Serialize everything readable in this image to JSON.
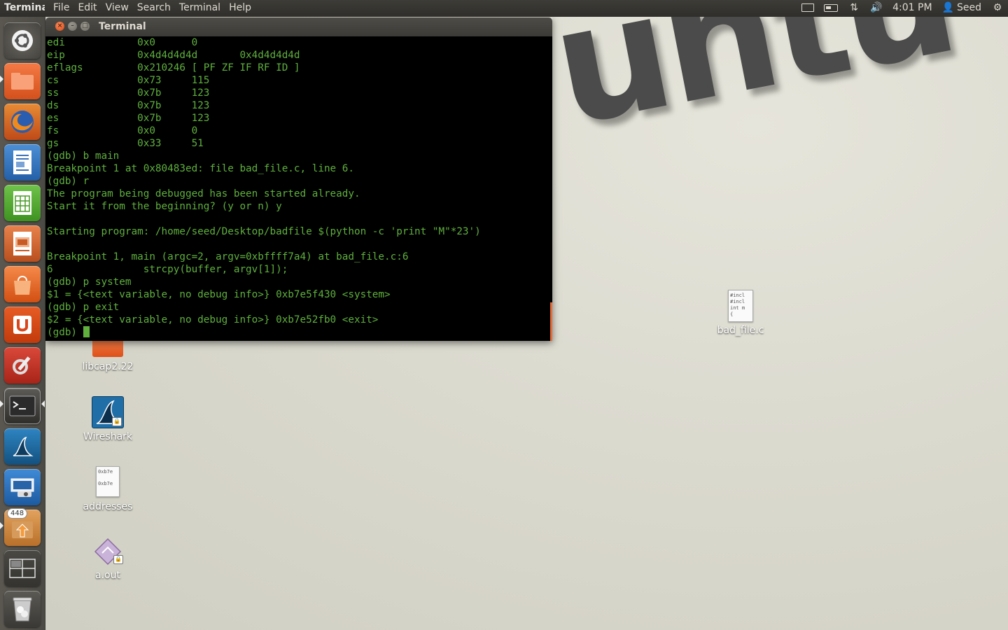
{
  "panel": {
    "app_name": "Terminal",
    "menu": [
      "File",
      "Edit",
      "View",
      "Search",
      "Terminal",
      "Help"
    ],
    "time": "4:01 PM",
    "user": "Seed"
  },
  "launcher": {
    "items": [
      {
        "name": "dash-home",
        "icon": "ubuntu-logo-icon"
      },
      {
        "name": "files",
        "icon": "folder-icon"
      },
      {
        "name": "firefox",
        "icon": "firefox-icon"
      },
      {
        "name": "libreoffice-writer",
        "icon": "writer-icon"
      },
      {
        "name": "libreoffice-calc",
        "icon": "calc-icon"
      },
      {
        "name": "libreoffice-impress",
        "icon": "impress-icon"
      },
      {
        "name": "software-center",
        "icon": "shopping-bag-icon"
      },
      {
        "name": "ubuntu-one",
        "icon": "ubuntu-one-icon"
      },
      {
        "name": "system-settings",
        "icon": "settings-icon"
      },
      {
        "name": "terminal",
        "icon": "terminal-icon"
      },
      {
        "name": "wireshark",
        "icon": "wireshark-icon"
      },
      {
        "name": "screenshot",
        "icon": "camera-icon"
      },
      {
        "name": "update-manager",
        "icon": "update-icon",
        "badge": "448"
      },
      {
        "name": "workspace-switcher",
        "icon": "workspaces-icon"
      },
      {
        "name": "trash",
        "icon": "trash-icon"
      }
    ]
  },
  "terminal": {
    "title": "Terminal",
    "lines": [
      "edi            0x0      0",
      "eip            0x4d4d4d4d       0x4d4d4d4d",
      "eflags         0x210246 [ PF ZF IF RF ID ]",
      "cs             0x73     115",
      "ss             0x7b     123",
      "ds             0x7b     123",
      "es             0x7b     123",
      "fs             0x0      0",
      "gs             0x33     51",
      "(gdb) b main",
      "Breakpoint 1 at 0x80483ed: file bad_file.c, line 6.",
      "(gdb) r",
      "The program being debugged has been started already.",
      "Start it from the beginning? (y or n) y",
      "",
      "Starting program: /home/seed/Desktop/badfile $(python -c 'print \"M\"*23')",
      "",
      "Breakpoint 1, main (argc=2, argv=0xbffff7a4) at bad_file.c:6",
      "6               strcpy(buffer, argv[1]);",
      "(gdb) p system",
      "$1 = {<text variable, no debug info>} 0xb7e5f430 <system>",
      "(gdb) p exit",
      "$2 = {<text variable, no debug info>} 0xb7e52fb0 <exit>"
    ],
    "prompt": "(gdb) "
  },
  "desktop": {
    "wallpaper_text": "untu",
    "icons": [
      {
        "label": "libcap2.22",
        "type": "folder"
      },
      {
        "label": "Wireshark",
        "type": "app"
      },
      {
        "label": "addresses",
        "type": "text-file",
        "preview": [
          "0xb7e",
          "0xb7e"
        ]
      },
      {
        "label": "a.out",
        "type": "executable"
      },
      {
        "label": "bad_file.c",
        "type": "c-source",
        "preview": [
          "#incl",
          "#incl",
          "int m",
          "{"
        ]
      }
    ]
  },
  "colors": {
    "terminal_text": "#5fb03d",
    "terminal_bg": "#000000",
    "panel_bg": "#3a3935",
    "launcher_bg": "#55524b",
    "accent_orange": "#dd4814"
  }
}
